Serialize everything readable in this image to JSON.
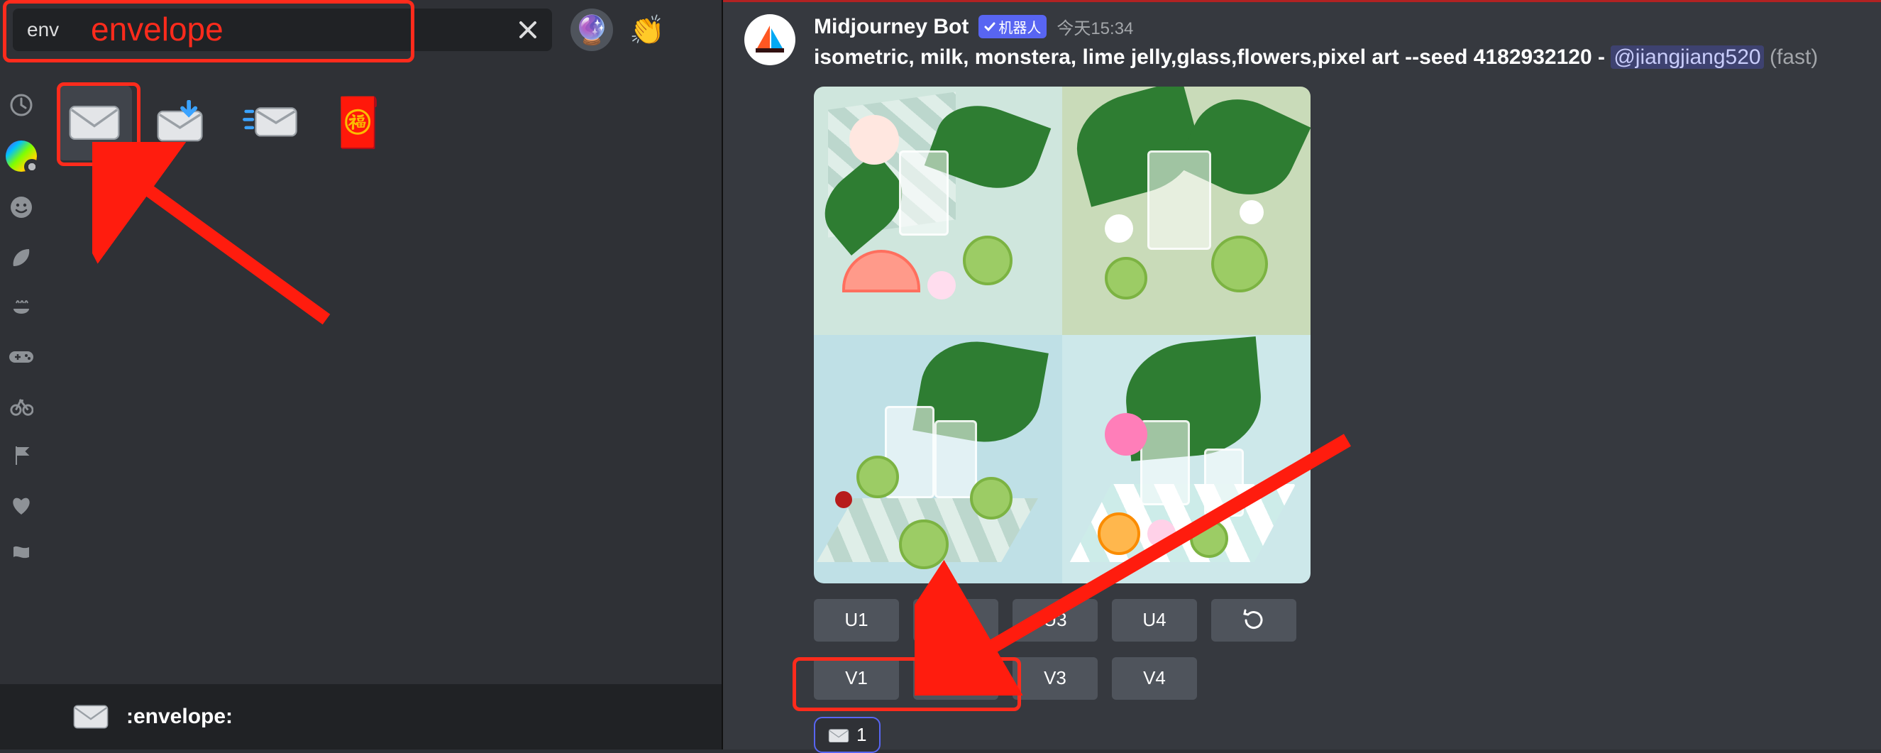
{
  "emoji_picker": {
    "search_value": "env",
    "annotation_label": "envelope",
    "tone_icons": [
      "🔮",
      "👏"
    ],
    "results": [
      {
        "name": "envelope",
        "glyph": "envelope-svg",
        "selected": true
      },
      {
        "name": "incoming_envelope",
        "glyph": "incoming-envelope-svg",
        "selected": false
      },
      {
        "name": "envelope_with_arrow",
        "glyph": "flying-envelope-svg",
        "selected": false
      },
      {
        "name": "red_envelope",
        "glyph": "🧧",
        "selected": false
      }
    ],
    "preview_code": ":envelope:",
    "categories": [
      "clock",
      "midjourney",
      "smiley",
      "leaf",
      "food",
      "game",
      "bike",
      "flag-pole",
      "heart",
      "flag"
    ]
  },
  "message": {
    "author": "Midjourney Bot",
    "bot_tag": "机器人",
    "timestamp": "今天15:34",
    "prompt": "isometric, milk, monstera, lime jelly,glass,flowers,pixel art --seed 4182932120",
    "mention": "@jiangjiang520",
    "speed": "(fast)",
    "buttons_row1": [
      "U1",
      "U2",
      "U3",
      "U4"
    ],
    "buttons_row2": [
      "V1",
      "V2",
      "V3",
      "V4"
    ],
    "redo_label": "redo",
    "reaction_count": "1"
  }
}
